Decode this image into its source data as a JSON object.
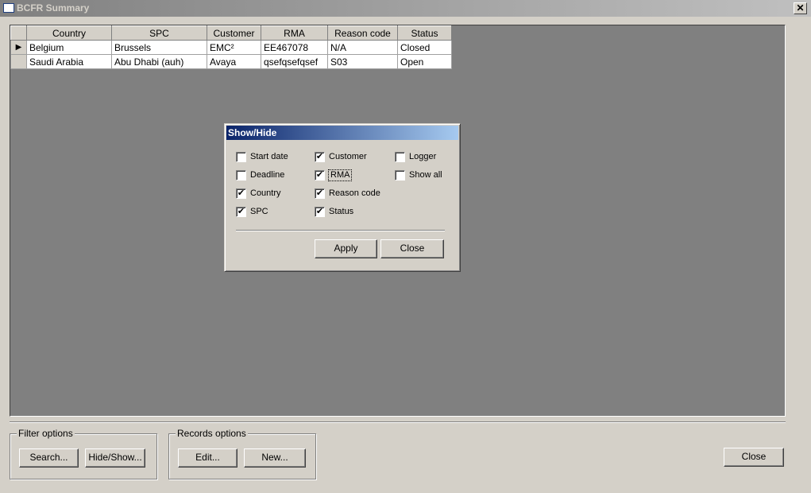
{
  "window": {
    "title": "BCFR Summary",
    "close": "✕"
  },
  "table": {
    "columns": [
      "Country",
      "SPC",
      "Customer",
      "RMA",
      "Reason code",
      "Status"
    ],
    "rows": [
      [
        "Belgium",
        "Brussels",
        "EMC²",
        "EE467078",
        "N/A",
        "Closed"
      ],
      [
        "Saudi Arabia",
        "Abu Dhabi (auh)",
        "Avaya",
        "qsefqsefqsef",
        "S03",
        "Open"
      ]
    ]
  },
  "filter": {
    "label": "Filter options",
    "search": "Search...",
    "hideshow": "Hide/Show..."
  },
  "records": {
    "label": "Records options",
    "edit": "Edit...",
    "new": "New..."
  },
  "close_label": "Close",
  "dialog": {
    "title": "Show/Hide",
    "options": [
      {
        "label": "Start date",
        "checked": false
      },
      {
        "label": "Deadline",
        "checked": false
      },
      {
        "label": "Country",
        "checked": true
      },
      {
        "label": "SPC",
        "checked": true
      },
      {
        "label": "Customer",
        "checked": true
      },
      {
        "label": "RMA",
        "checked": true
      },
      {
        "label": "Reason code",
        "checked": true
      },
      {
        "label": "Status",
        "checked": true
      },
      {
        "label": "Logger",
        "checked": false
      },
      {
        "label": "Show all",
        "checked": false
      }
    ],
    "apply": "Apply",
    "close": "Close"
  }
}
